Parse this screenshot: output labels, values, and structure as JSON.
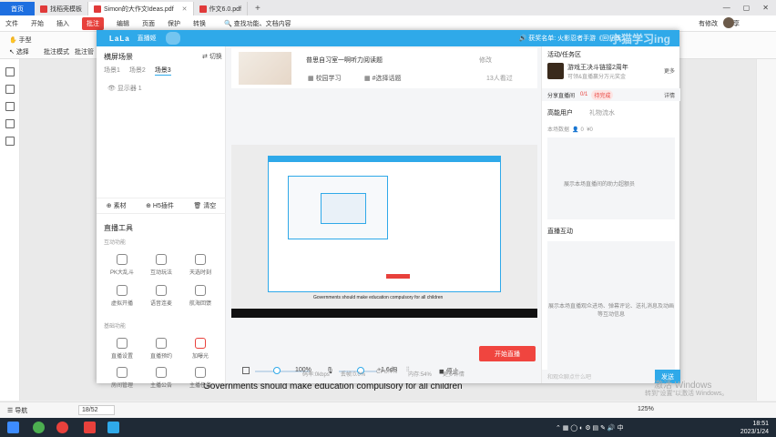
{
  "tabs": {
    "home": "首页",
    "items": [
      {
        "label": "找稻壳模板",
        "active": false
      },
      {
        "label": "Simon的大作文Ideas.pdf",
        "active": true
      },
      {
        "label": "作文6.0.pdf",
        "active": false
      }
    ]
  },
  "menu": {
    "file": "文件",
    "items": [
      "开始",
      "插入",
      "批注",
      "编辑",
      "页面",
      "保护",
      "转换"
    ],
    "active_index": 2,
    "search": "查找功能、文档内容",
    "modified": "有修改",
    "share": "分享"
  },
  "toolbar": {
    "hand": "手型",
    "select": "选择",
    "annot_mode": "批注模式",
    "annot_mgr": "批注管"
  },
  "live": {
    "logo": "LaLa",
    "app_name": "直播姬",
    "ticker": "获奖名单: 火影忍者手游《回归季...",
    "watermark": "小猫学习ing",
    "left": {
      "title": "横屏场景",
      "switch": "切换",
      "scenes": [
        "场景1",
        "场景2",
        "场景3"
      ],
      "active_scene": 2,
      "monitor": "显示器 1",
      "sources": [
        "素材",
        "H5插件",
        "清空"
      ],
      "tools_title": "直播工具",
      "interact_label": "互动功能",
      "interact_tools": [
        "PK大乱斗",
        "互动玩法",
        "天选时刻",
        "虚拟开播",
        "语音连麦",
        "航海回馈"
      ],
      "basic_label": "基础功能",
      "basic_tools": [
        "直播设置",
        "直播预约",
        "加曝光",
        "房间管理",
        "主播公告",
        "主播任务"
      ]
    },
    "center": {
      "room_name": "普思自习室一啊听力阅读题",
      "edit": "修改",
      "tag1": "校园学习",
      "tag2": "#选择话题",
      "viewers": "13人看过",
      "preview_caption": "Governments should make education compulsory for all children",
      "volume": "100%",
      "mic_db": "+1.6dB",
      "stop": "停止",
      "start": "开始直播",
      "stats": [
        "码率:0kbps",
        "丢帧:0.0%",
        "CPU:4%",
        "内存:54%",
        "更多详情"
      ]
    },
    "right": {
      "task_title": "活动/任务区",
      "ad_title": "游戏王决斗链接2周年",
      "ad_sub": "可领&直播赢分万元奖金",
      "more": "更多",
      "share_label": "分享直播间",
      "share_progress": "0/1",
      "share_pill": "待完成",
      "details": "详情",
      "hl_users": "高能用户",
      "gift_flow": "礼物流水",
      "today_data": "本场数据",
      "zero1": "0",
      "zero2": "¥0",
      "empty_msg": "展示本场直播间的助力超额员",
      "interaction": "直播互动",
      "interaction_msg": "展示本场直播观众进场、弹幕评论、送礼消息及动画等互动信息",
      "send_placeholder": "和观众聊点什么吧",
      "send": "发送"
    }
  },
  "doc": {
    "text": "Governments should make education compulsory for all children"
  },
  "activation": {
    "title": "激活 Windows",
    "sub": "转到\"设置\"以激活 Windows。"
  },
  "status": {
    "nav": "导航",
    "page": "18/52",
    "zoom": "125%"
  },
  "clock": {
    "time": "18:51",
    "date": "2023/1/24"
  },
  "colors": {
    "accent": "#2fa9e9",
    "danger": "#f0453f",
    "wps_red": "#e8413c"
  }
}
